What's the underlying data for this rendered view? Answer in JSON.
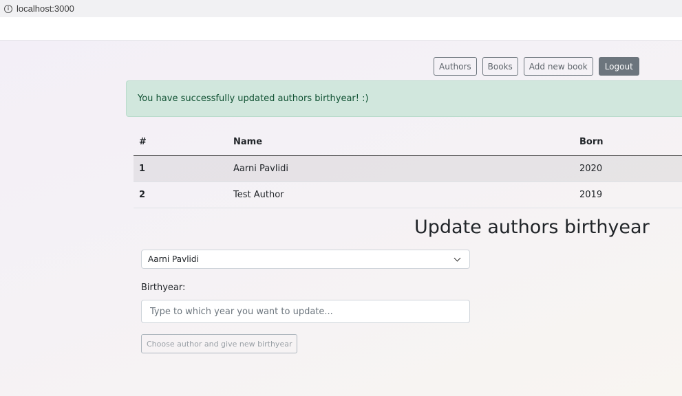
{
  "browser": {
    "url": "localhost:3000"
  },
  "nav": {
    "authors": "Authors",
    "books": "Books",
    "add_book": "Add new book",
    "logout": "Logout"
  },
  "alert": {
    "message": "You have successfully updated authors birthyear! :)"
  },
  "table": {
    "headers": [
      "#",
      "Name",
      "Born"
    ],
    "rows": [
      [
        "1",
        "Aarni Pavlidi",
        "2020"
      ],
      [
        "2",
        "Test Author",
        "2019"
      ]
    ]
  },
  "form": {
    "heading": "Update authors birthyear",
    "selected_author": "Aarni Pavlidi",
    "birthyear_label": "Birthyear:",
    "birthyear_placeholder": "Type to which year you want to update...",
    "submit_label": "Choose author and give new birthyear"
  },
  "colors": {
    "alert_bg": "#d1e7dd",
    "alert_text": "#0f5132",
    "logout_bg": "#6c757d"
  }
}
